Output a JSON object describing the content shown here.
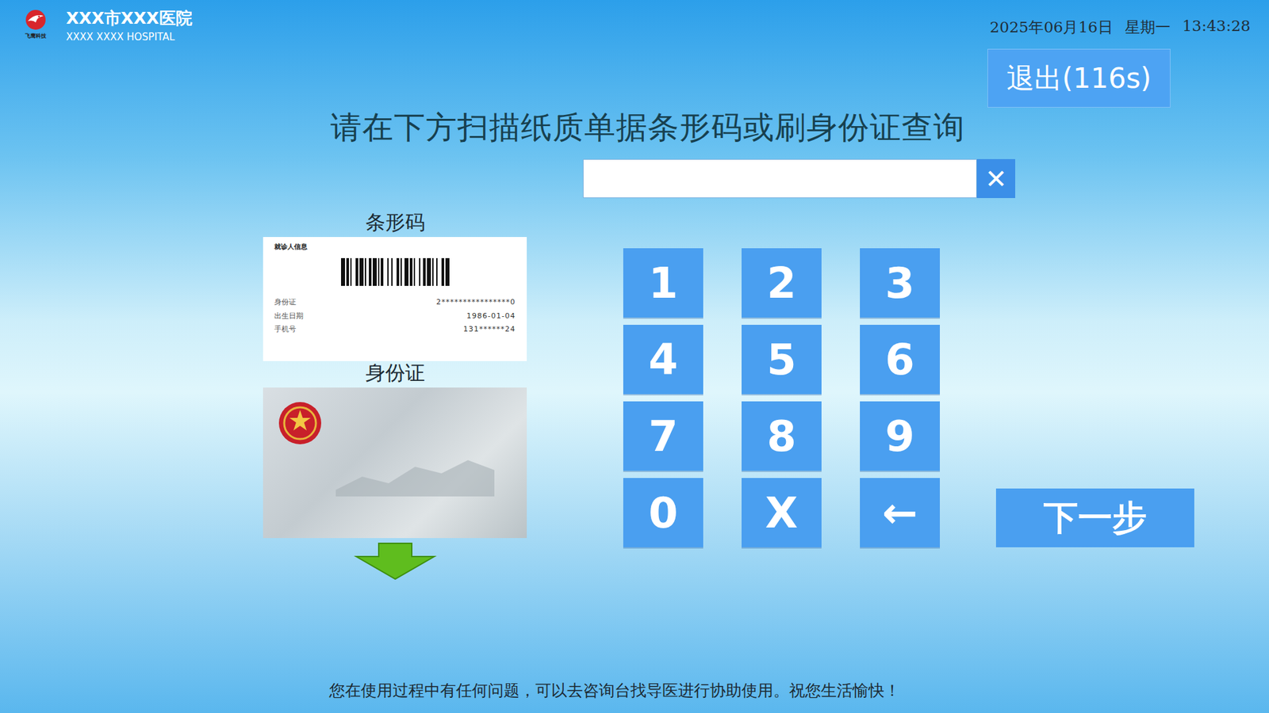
{
  "header": {
    "logo_text": "飞鹰科技",
    "hospital_name": "XXX市XXX医院",
    "hospital_name_en": "XXXX XXXX HOSPITAL",
    "date": "2025年06月16日",
    "weekday": "星期一",
    "time": "13:43:28"
  },
  "exit_button": "退出(116s)",
  "instruction": "请在下方扫描纸质单据条形码或刷身份证查询",
  "input": {
    "value": "",
    "clear": "✕"
  },
  "examples": {
    "barcode_label": "条形码",
    "barcode_card": {
      "title": "就诊人信息",
      "rows": [
        {
          "label": "身份证",
          "value": "2****************0"
        },
        {
          "label": "出生日期",
          "value": "1986-01-04"
        },
        {
          "label": "手机号",
          "value": "131******24"
        }
      ]
    },
    "id_card_label": "身份证"
  },
  "keypad": [
    "1",
    "2",
    "3",
    "4",
    "5",
    "6",
    "7",
    "8",
    "9",
    "0",
    "X",
    "←"
  ],
  "next_button": "下一步",
  "footer": "您在使用过程中有任何问题，可以去咨询台找导医进行协助使用。祝您生活愉快！"
}
